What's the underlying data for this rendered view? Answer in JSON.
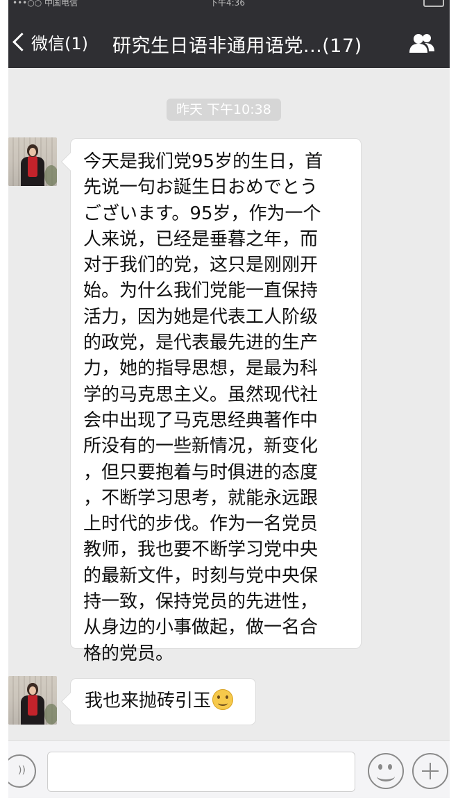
{
  "status_bar": {
    "carrier": "•••○○ 中国电信",
    "time": "下午4:36"
  },
  "header": {
    "back_label": "微信(1)",
    "title": "研究生日语非通用语党...(17)",
    "group_icon": "group-members-icon"
  },
  "chat": {
    "timestamp": "昨天 下午10:38",
    "messages": [
      {
        "sender_avatar": "avatar",
        "text": "今天是我们党95岁的生日，首\n先说一句お誕生日おめでとう\nございます。95岁，作为一个\n人来说，已经是垂暮之年，而\n对于我们的党，这只是刚刚开\n始。为什么我们党能一直保持\n活力，因为她是代表工人阶级\n的政党，是代表最先进的生产\n力，她的指导思想，是最为科\n学的马克思主义。虽然现代社\n会中出现了马克思经典著作中\n所没有的一些新情况，新变化\n，但只要抱着与时俱进的态度\n，不断学习思考，就能永远跟\n上时代的步伐。作为一名党员\n教师，我也要不断学习党中央\n的最新文件，时刻与党中央保\n持一致，保持党员的先进性，\n从身边的小事做起，做一名合\n格的党员。"
      },
      {
        "sender_avatar": "avatar",
        "text": "我也来抛砖引玉",
        "emoji": "smile-emoji-icon"
      }
    ]
  },
  "input_bar": {
    "voice_icon": "voice-icon",
    "emoji_icon": "emoji-icon",
    "plus_icon": "plus-icon",
    "placeholder": ""
  }
}
